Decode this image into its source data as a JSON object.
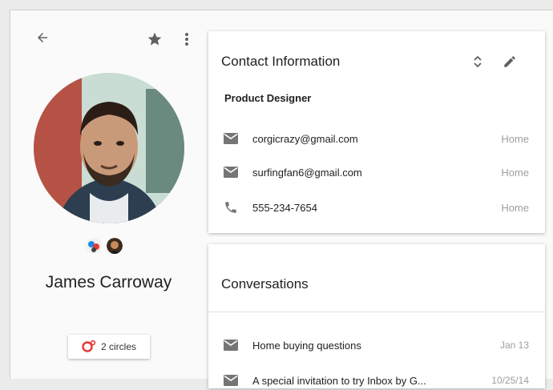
{
  "contact": {
    "name": "James Carroway",
    "circles_label": "2 circles",
    "icons": {
      "back": "arrow-left-icon",
      "star": "star-icon",
      "more": "more-vert-icon",
      "expand": "unfold-icon",
      "edit": "pencil-icon",
      "email": "mail-icon",
      "phone": "phone-icon",
      "circles": "google-circles-icon"
    }
  },
  "contact_info": {
    "title": "Contact Information",
    "role": "Product Designer",
    "entries": [
      {
        "type": "email",
        "value": "corgicrazy@gmail.com",
        "label": "Home"
      },
      {
        "type": "email",
        "value": "surfingfan6@gmail.com",
        "label": "Home"
      },
      {
        "type": "phone",
        "value": "555-234-7654",
        "label": "Home"
      }
    ]
  },
  "conversations": {
    "title": "Conversations",
    "items": [
      {
        "subject": "Home buying questions",
        "date": "Jan 13"
      },
      {
        "subject": "A special invitation to try Inbox by G...",
        "date": "10/25/14"
      }
    ]
  },
  "colors": {
    "accent_red": "#e53935",
    "icon_grey": "#757575",
    "meta_grey": "#9e9e9e"
  }
}
